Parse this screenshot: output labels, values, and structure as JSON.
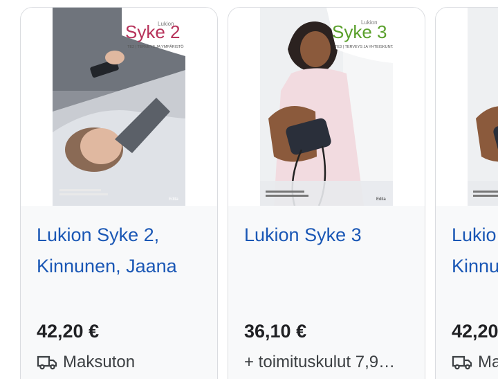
{
  "products": [
    {
      "cover": {
        "series_small": "Lukion",
        "series": "Syke 2",
        "subtitle": "TE2 | TERVEYS JA YMPÄRISTÖ",
        "publisher": "Edita",
        "accent": "#b7325a"
      },
      "title_line1": "Lukion Syke 2,",
      "title_line2": "Kinnunen, Jaana",
      "price": "42,20 €",
      "shipping_text": "Maksuton",
      "shipping_icon": "truck-icon"
    },
    {
      "cover": {
        "series_small": "Lukion",
        "series": "Syke 3",
        "subtitle": "TE3 | TERVEYS JA YHTEISKUNTA",
        "publisher": "Edita",
        "accent": "#5aa02c"
      },
      "title_line1": "Lukion Syke 3",
      "title_line2": "",
      "price": "36,10 €",
      "shipping_text": "+ toimituskulut 7,9…",
      "shipping_icon": ""
    },
    {
      "cover": {
        "series_small": "",
        "series": "",
        "subtitle": "",
        "publisher": "",
        "accent": "#5aa02c"
      },
      "title_line1": "Lukio",
      "title_line2": "Kinnu",
      "price": "42,20",
      "shipping_text": "Ma",
      "shipping_icon": "truck-icon"
    }
  ]
}
